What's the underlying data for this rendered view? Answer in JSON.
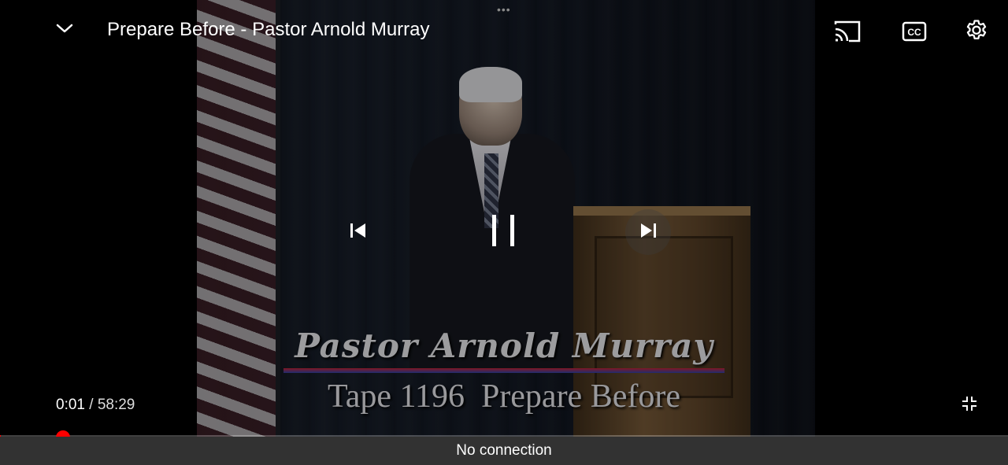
{
  "header": {
    "title": "Prepare Before - Pastor Arnold Murray",
    "drag_handle": "•••"
  },
  "video_overlay": {
    "name_text": "Pastor Arnold Murray",
    "sub_text": "Tape 1196  Prepare Before"
  },
  "icons": {
    "collapse": "chevron-down-icon",
    "cast": "cast-icon",
    "captions": "closed-captions-icon",
    "settings": "gear-icon",
    "previous": "skip-previous-icon",
    "pause": "pause-icon",
    "next": "skip-next-icon",
    "exit_fullscreen": "exit-fullscreen-icon"
  },
  "playback": {
    "current_time": "0:01",
    "separator": "/",
    "duration": "58:29",
    "progress_fraction": 0.0003
  },
  "colors": {
    "progress": "#ff0000",
    "snackbar_bg": "#323232"
  },
  "snackbar": {
    "message": "No connection"
  }
}
